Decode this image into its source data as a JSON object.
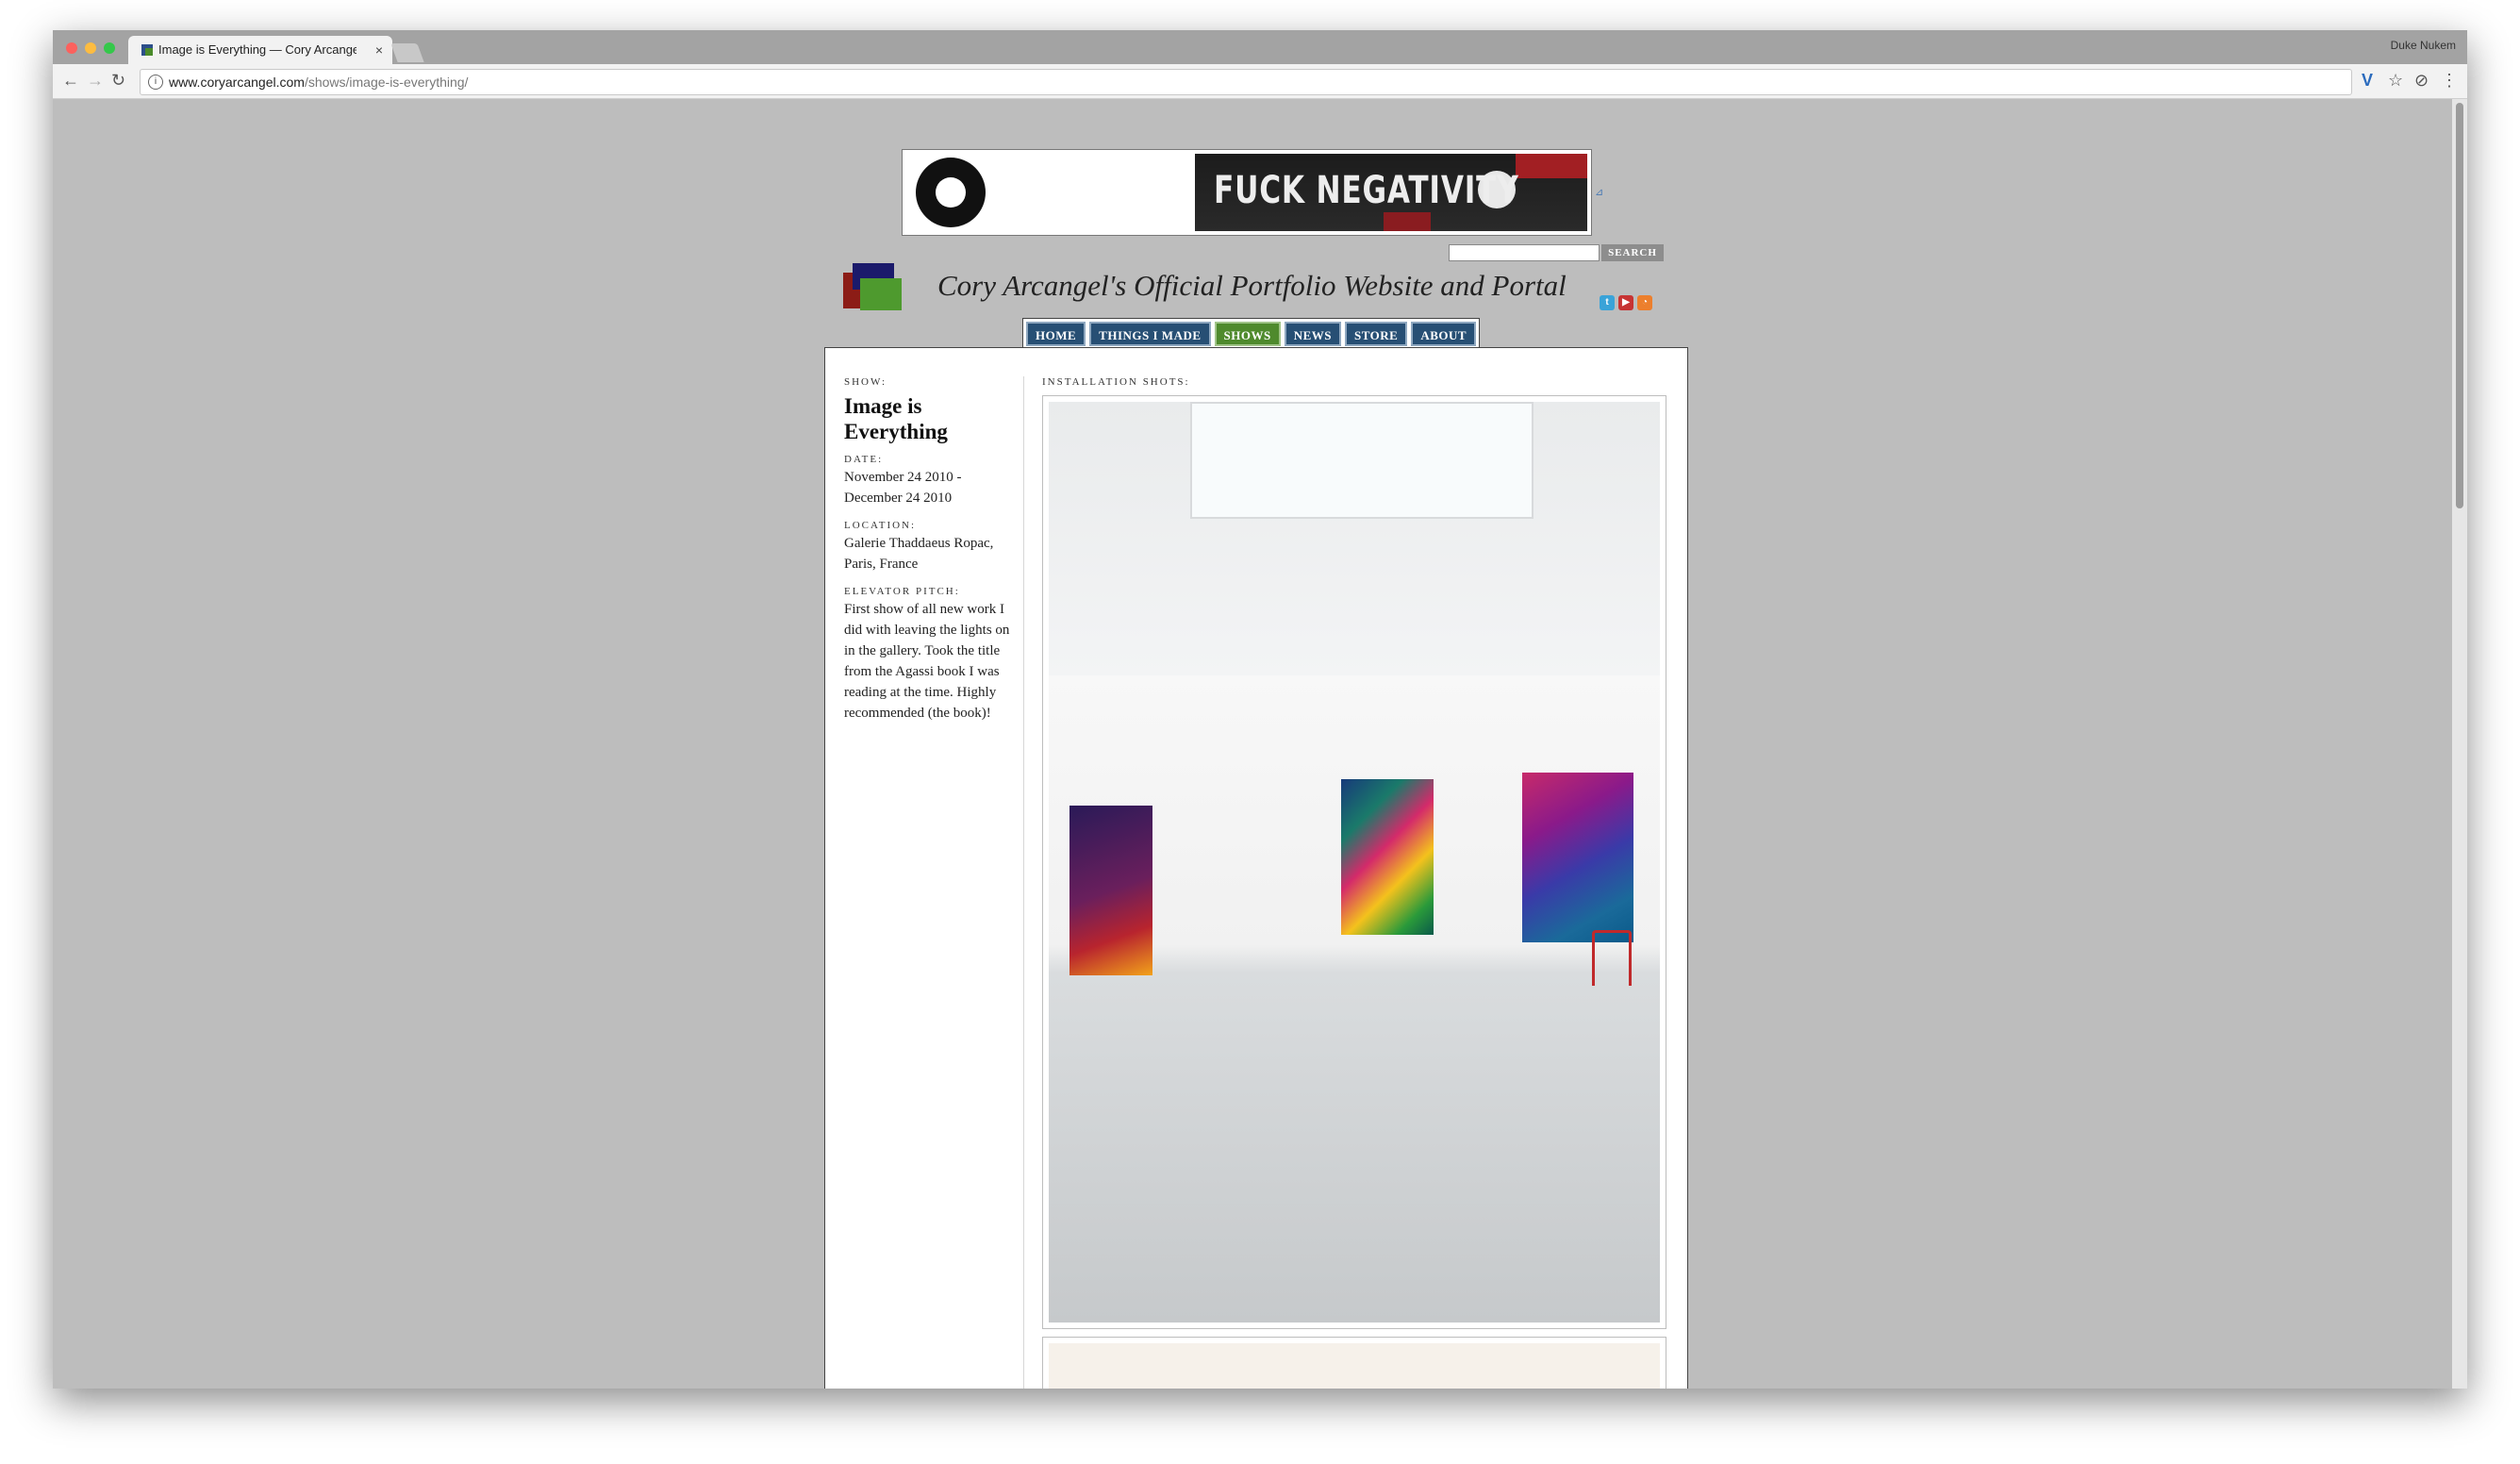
{
  "browser": {
    "tab_title": "Image is Everything — Cory Arcangel",
    "tab_close": "×",
    "profile_name": "Duke Nukem",
    "url_host": "www.coryarcangel.com",
    "url_path": "/shows/image-is-everything/",
    "back_glyph": "←",
    "forward_glyph": "→",
    "reload_glyph": "↻",
    "info_glyph": "i",
    "ext_v_glyph": "V",
    "star_glyph": "☆",
    "ext2_glyph": "⊘",
    "menu_glyph": "⋮"
  },
  "ad": {
    "text": "FUCK NEGATIVITY",
    "corner_glyph": "⊿"
  },
  "search": {
    "button": "SEARCH",
    "placeholder": ""
  },
  "site": {
    "title": "Cory Arcangel's Official Portfolio Website and Portal",
    "social": [
      {
        "name": "twitter",
        "glyph": "t",
        "color": "#3aa3d8"
      },
      {
        "name": "youtube",
        "glyph": "▶",
        "color": "#c73333"
      },
      {
        "name": "rss",
        "glyph": "◔",
        "color": "#ec7f2d"
      }
    ],
    "logo_colors": [
      "#1b1a6b",
      "#8c1c16",
      "#4e9a2e"
    ]
  },
  "nav": [
    {
      "label": "HOME",
      "active": false
    },
    {
      "label": "THINGS I MADE",
      "active": false
    },
    {
      "label": "SHOWS",
      "active": true
    },
    {
      "label": "NEWS",
      "active": false
    },
    {
      "label": "STORE",
      "active": false
    },
    {
      "label": "ABOUT",
      "active": false
    }
  ],
  "show": {
    "show_label": "SHOW:",
    "title": "Image is Everything",
    "date_label": "DATE:",
    "date": "November 24 2010 - December 24 2010",
    "location_label": "LOCATION:",
    "location": "Galerie Thaddaeus Ropac, Paris, France",
    "pitch_label": "ELEVATOR PITCH:",
    "pitch": "First show of all new work I did with leaving the lights on in the gallery. Took the title from the Agassi book I was reading at the time. Highly recommended (the book)!",
    "installation_label": "INSTALLATION SHOTS:"
  }
}
